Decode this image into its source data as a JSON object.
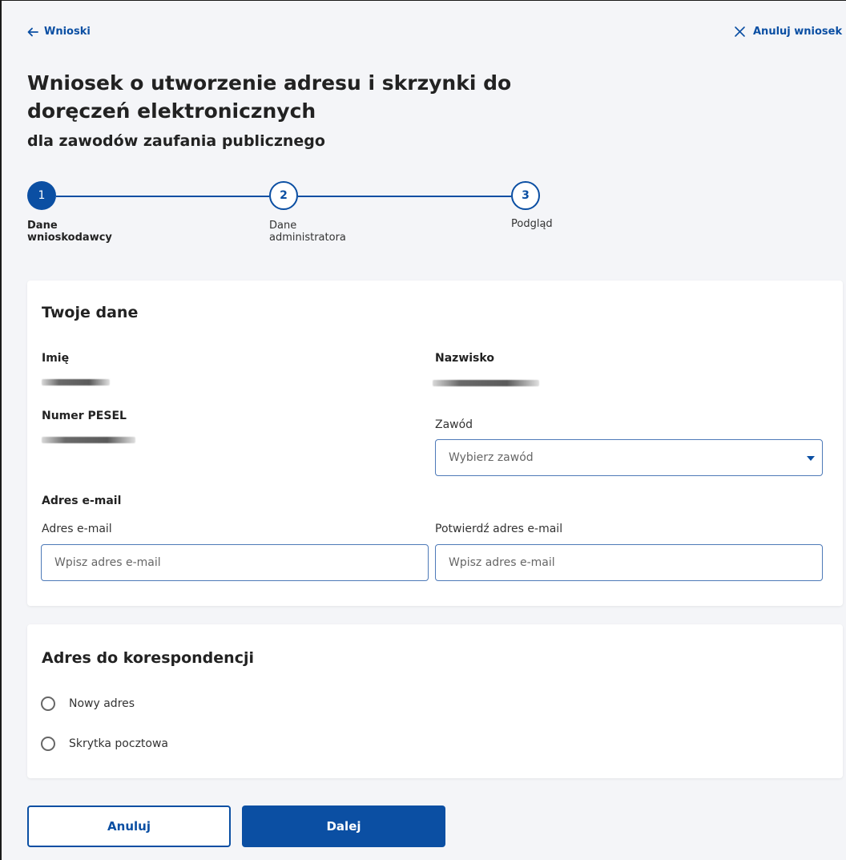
{
  "nav": {
    "back_label": "Wnioski",
    "cancel_label": "Anuluj wniosek"
  },
  "header": {
    "title": "Wniosek o utworzenie adresu i skrzynki do doręczeń elektronicznych",
    "subtitle": "dla zawodów zaufania publicznego"
  },
  "stepper": {
    "current_step": 1,
    "steps": [
      {
        "number": "1",
        "label": "Dane wnioskodawcy"
      },
      {
        "number": "2",
        "label": "Dane administratora"
      },
      {
        "number": "3",
        "label": "Podgląd"
      }
    ]
  },
  "personal": {
    "title": "Twoje dane",
    "first_name_label": "Imię",
    "last_name_label": "Nazwisko",
    "pesel_label": "Numer PESEL",
    "profession_label": "Zawód",
    "profession_placeholder": "Wybierz zawód",
    "email_section_title": "Adres e-mail",
    "email_label": "Adres e-mail",
    "email_placeholder": "Wpisz adres e-mail",
    "confirm_email_label": "Potwierdź adres e-mail",
    "confirm_email_placeholder": "Wpisz adres e-mail"
  },
  "correspondence": {
    "title": "Adres do korespondencji",
    "options": [
      "Nowy adres",
      "Skrytka pocztowa"
    ]
  },
  "buttons": {
    "cancel_label": "Anuluj",
    "next_label": "Dalej"
  },
  "colors": {
    "accent": "#0b4fa3",
    "background": "#f4f5f8"
  }
}
